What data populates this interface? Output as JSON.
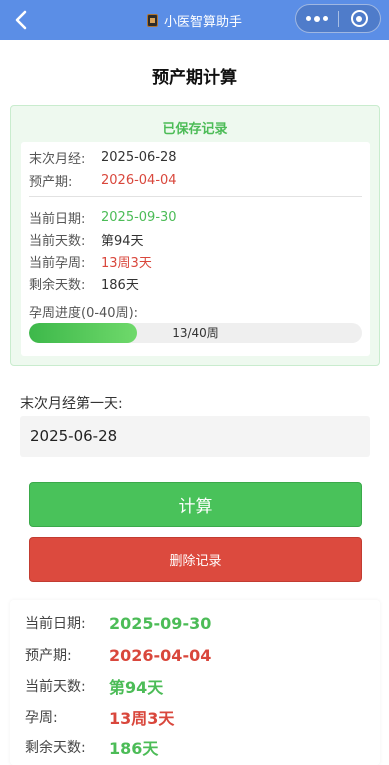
{
  "nav": {
    "title": "小医智算助手",
    "back_icon": "chevron-left-icon",
    "app_icon": "calculator-icon",
    "more_icon": "more-dots-icon",
    "close_icon": "target-circle-icon",
    "bar_color": "#5b8ee6"
  },
  "page": {
    "title": "预产期计算"
  },
  "saved": {
    "title": "已保存记录",
    "lmp_label": "末次月经:",
    "lmp_value": "2025-06-28",
    "due_label": "预产期:",
    "due_value": "2026-04-04",
    "today_label": "当前日期:",
    "today_value": "2025-09-30",
    "days_label": "当前天数:",
    "days_value": "第94天",
    "week_label": "当前孕周:",
    "week_value": "13周3天",
    "remain_label": "剩余天数:",
    "remain_value": "186天",
    "progress_label": "孕周进度(0-40周):",
    "progress_text": "13/40周",
    "progress_fraction": 0.325
  },
  "form": {
    "input_label": "末次月经第一天:",
    "input_value": "2025-06-28",
    "calc_button": "计算",
    "delete_button": "删除记录"
  },
  "result": {
    "today_label": "当前日期:",
    "today_value": "2025-09-30",
    "due_label": "预产期:",
    "due_value": "2026-04-04",
    "days_label": "当前天数:",
    "days_value": "第94天",
    "week_label": "孕周:",
    "week_value": "13周3天",
    "remain_label": "剩余天数:",
    "remain_value": "186天"
  },
  "colors": {
    "green": "#4cbc57",
    "red": "#d9473c",
    "button_green": "#49c25a",
    "button_red": "#dc4a3e"
  }
}
